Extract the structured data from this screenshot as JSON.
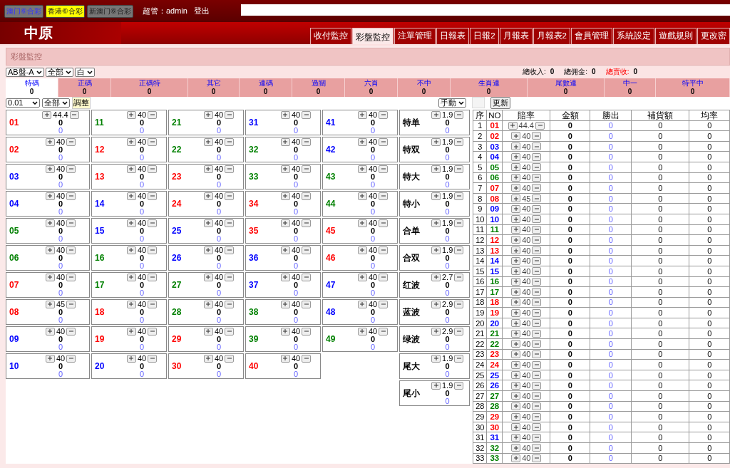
{
  "top_bar": {
    "sites": [
      {
        "label": "澳门⑥合彩",
        "selected": false,
        "kind": "link"
      },
      {
        "label": "香港⑥合彩",
        "selected": true,
        "kind": "plain"
      },
      {
        "label": "新澳门⑥合彩",
        "selected": false,
        "kind": "plain"
      }
    ],
    "user": "超管：admin",
    "logout": "登出"
  },
  "logo": "中原",
  "nav_tabs": [
    {
      "label": "收付監控",
      "selected": false
    },
    {
      "label": "彩盤監控",
      "selected": true
    },
    {
      "label": "注單管理",
      "selected": false
    },
    {
      "label": "日報表",
      "selected": false
    },
    {
      "label": "日報2",
      "selected": false
    },
    {
      "label": "月報表",
      "selected": false
    },
    {
      "label": "月報表2",
      "selected": false
    },
    {
      "label": "會員管理",
      "selected": false
    },
    {
      "label": "系統設定",
      "selected": false
    },
    {
      "label": "遊戲規則",
      "selected": false
    },
    {
      "label": "更改密",
      "selected": false
    }
  ],
  "panel_title": "彩盤監控",
  "filters": [
    "AB盤-A",
    "全部",
    "白"
  ],
  "totals": [
    {
      "label": "總收入:",
      "value": "0",
      "kind": "normal"
    },
    {
      "label": "總佣金:",
      "value": "0",
      "kind": "normal"
    },
    {
      "label": "總賣收:",
      "value": "0",
      "kind": "alert"
    }
  ],
  "categories": [
    {
      "label": "特碼",
      "value": "0",
      "selected": true
    },
    {
      "label": "正碼",
      "value": "0",
      "selected": false
    },
    {
      "label": "正碼特",
      "value": "0",
      "selected": false
    },
    {
      "label": "其它",
      "value": "0",
      "selected": false
    },
    {
      "label": "連碼",
      "value": "0",
      "selected": false
    },
    {
      "label": "過關",
      "value": "0",
      "selected": false
    },
    {
      "label": "六肖",
      "value": "0",
      "selected": false
    },
    {
      "label": "不中",
      "value": "0",
      "selected": false
    },
    {
      "label": "生肖連",
      "value": "0",
      "selected": false
    },
    {
      "label": "尾數連",
      "value": "0",
      "selected": false
    },
    {
      "label": "中一",
      "value": "0",
      "selected": false
    },
    {
      "label": "特平中",
      "value": "0",
      "selected": false
    }
  ],
  "step_select": "0.01",
  "scope_select": "全部",
  "adjust_button": "調整",
  "mode_select": "手動",
  "refresh_button": "更新",
  "balls": [
    {
      "no": "01",
      "color": "#ff0000",
      "odds": "44.4",
      "amount": "0",
      "win": "0"
    },
    {
      "no": "02",
      "color": "#ff0000",
      "odds": "40",
      "amount": "0",
      "win": "0"
    },
    {
      "no": "03",
      "color": "#0000ff",
      "odds": "40",
      "amount": "0",
      "win": "0"
    },
    {
      "no": "04",
      "color": "#0000ff",
      "odds": "40",
      "amount": "0",
      "win": "0"
    },
    {
      "no": "05",
      "color": "#008000",
      "odds": "40",
      "amount": "0",
      "win": "0"
    },
    {
      "no": "06",
      "color": "#008000",
      "odds": "40",
      "amount": "0",
      "win": "0"
    },
    {
      "no": "07",
      "color": "#ff0000",
      "odds": "40",
      "amount": "0",
      "win": "0"
    },
    {
      "no": "08",
      "color": "#ff0000",
      "odds": "45",
      "amount": "0",
      "win": "0"
    },
    {
      "no": "09",
      "color": "#0000ff",
      "odds": "40",
      "amount": "0",
      "win": "0"
    },
    {
      "no": "10",
      "color": "#0000ff",
      "odds": "40",
      "amount": "0",
      "win": "0"
    },
    {
      "no": "11",
      "color": "#008000",
      "odds": "40",
      "amount": "0",
      "win": "0"
    },
    {
      "no": "12",
      "color": "#ff0000",
      "odds": "40",
      "amount": "0",
      "win": "0"
    },
    {
      "no": "13",
      "color": "#ff0000",
      "odds": "40",
      "amount": "0",
      "win": "0"
    },
    {
      "no": "14",
      "color": "#0000ff",
      "odds": "40",
      "amount": "0",
      "win": "0"
    },
    {
      "no": "15",
      "color": "#0000ff",
      "odds": "40",
      "amount": "0",
      "win": "0"
    },
    {
      "no": "16",
      "color": "#008000",
      "odds": "40",
      "amount": "0",
      "win": "0"
    },
    {
      "no": "17",
      "color": "#008000",
      "odds": "40",
      "amount": "0",
      "win": "0"
    },
    {
      "no": "18",
      "color": "#ff0000",
      "odds": "40",
      "amount": "0",
      "win": "0"
    },
    {
      "no": "19",
      "color": "#ff0000",
      "odds": "40",
      "amount": "0",
      "win": "0"
    },
    {
      "no": "20",
      "color": "#0000ff",
      "odds": "40",
      "amount": "0",
      "win": "0"
    },
    {
      "no": "21",
      "color": "#008000",
      "odds": "40",
      "amount": "0",
      "win": "0"
    },
    {
      "no": "22",
      "color": "#008000",
      "odds": "40",
      "amount": "0",
      "win": "0"
    },
    {
      "no": "23",
      "color": "#ff0000",
      "odds": "40",
      "amount": "0",
      "win": "0"
    },
    {
      "no": "24",
      "color": "#ff0000",
      "odds": "40",
      "amount": "0",
      "win": "0"
    },
    {
      "no": "25",
      "color": "#0000ff",
      "odds": "40",
      "amount": "0",
      "win": "0"
    },
    {
      "no": "26",
      "color": "#0000ff",
      "odds": "40",
      "amount": "0",
      "win": "0"
    },
    {
      "no": "27",
      "color": "#008000",
      "odds": "40",
      "amount": "0",
      "win": "0"
    },
    {
      "no": "28",
      "color": "#008000",
      "odds": "40",
      "amount": "0",
      "win": "0"
    },
    {
      "no": "29",
      "color": "#ff0000",
      "odds": "40",
      "amount": "0",
      "win": "0"
    },
    {
      "no": "30",
      "color": "#ff0000",
      "odds": "40",
      "amount": "0",
      "win": "0"
    },
    {
      "no": "31",
      "color": "#0000ff",
      "odds": "40",
      "amount": "0",
      "win": "0"
    },
    {
      "no": "32",
      "color": "#008000",
      "odds": "40",
      "amount": "0",
      "win": "0"
    },
    {
      "no": "33",
      "color": "#008000",
      "odds": "40",
      "amount": "0",
      "win": "0"
    },
    {
      "no": "34",
      "color": "#ff0000",
      "odds": "40",
      "amount": "0",
      "win": "0"
    },
    {
      "no": "35",
      "color": "#ff0000",
      "odds": "40",
      "amount": "0",
      "win": "0"
    },
    {
      "no": "36",
      "color": "#0000ff",
      "odds": "40",
      "amount": "0",
      "win": "0"
    },
    {
      "no": "37",
      "color": "#0000ff",
      "odds": "40",
      "amount": "0",
      "win": "0"
    },
    {
      "no": "38",
      "color": "#008000",
      "odds": "40",
      "amount": "0",
      "win": "0"
    },
    {
      "no": "39",
      "color": "#008000",
      "odds": "40",
      "amount": "0",
      "win": "0"
    },
    {
      "no": "40",
      "color": "#ff0000",
      "odds": "40",
      "amount": "0",
      "win": "0"
    },
    {
      "no": "41",
      "color": "#0000ff",
      "odds": "40",
      "amount": "0",
      "win": "0"
    },
    {
      "no": "42",
      "color": "#0000ff",
      "odds": "40",
      "amount": "0",
      "win": "0"
    },
    {
      "no": "43",
      "color": "#008000",
      "odds": "40",
      "amount": "0",
      "win": "0"
    },
    {
      "no": "44",
      "color": "#008000",
      "odds": "40",
      "amount": "0",
      "win": "0"
    },
    {
      "no": "45",
      "color": "#ff0000",
      "odds": "40",
      "amount": "0",
      "win": "0"
    },
    {
      "no": "46",
      "color": "#ff0000",
      "odds": "40",
      "amount": "0",
      "win": "0"
    },
    {
      "no": "47",
      "color": "#0000ff",
      "odds": "40",
      "amount": "0",
      "win": "0"
    },
    {
      "no": "48",
      "color": "#0000ff",
      "odds": "40",
      "amount": "0",
      "win": "0"
    },
    {
      "no": "49",
      "color": "#008000",
      "odds": "40",
      "amount": "0",
      "win": "0"
    }
  ],
  "side_bets": [
    {
      "label": "特单",
      "odds": "1.9",
      "amount": "0",
      "win": "0"
    },
    {
      "label": "特双",
      "odds": "1.9",
      "amount": "0",
      "win": "0"
    },
    {
      "label": "特大",
      "odds": "1.9",
      "amount": "0",
      "win": "0"
    },
    {
      "label": "特小",
      "odds": "1.9",
      "amount": "0",
      "win": "0"
    },
    {
      "label": "合单",
      "odds": "1.9",
      "amount": "0",
      "win": "0"
    },
    {
      "label": "合双",
      "odds": "1.9",
      "amount": "0",
      "win": "0"
    },
    {
      "label": "红波",
      "odds": "2.7",
      "amount": "0",
      "win": "0"
    },
    {
      "label": "蓝波",
      "odds": "2.9",
      "amount": "0",
      "win": "0"
    },
    {
      "label": "绿波",
      "odds": "2.9",
      "amount": "0",
      "win": "0"
    },
    {
      "label": "尾大",
      "odds": "1.9",
      "amount": "0",
      "win": "0"
    },
    {
      "label": "尾小",
      "odds": "1.9",
      "amount": "0",
      "win": "0"
    }
  ],
  "table": {
    "columns": [
      "序",
      "NO",
      "賠率",
      "金額",
      "勝出",
      "補貨額",
      "均率"
    ],
    "rows": [
      {
        "seq": "1",
        "no": "01",
        "color": "#ff0000",
        "odds": "44.4",
        "amount": "0",
        "win": "0",
        "cover": "0",
        "avg": "0"
      },
      {
        "seq": "2",
        "no": "02",
        "color": "#ff0000",
        "odds": "40",
        "amount": "0",
        "win": "0",
        "cover": "0",
        "avg": "0"
      },
      {
        "seq": "3",
        "no": "03",
        "color": "#0000ff",
        "odds": "40",
        "amount": "0",
        "win": "0",
        "cover": "0",
        "avg": "0"
      },
      {
        "seq": "4",
        "no": "04",
        "color": "#0000ff",
        "odds": "40",
        "amount": "0",
        "win": "0",
        "cover": "0",
        "avg": "0"
      },
      {
        "seq": "5",
        "no": "05",
        "color": "#008000",
        "odds": "40",
        "amount": "0",
        "win": "0",
        "cover": "0",
        "avg": "0"
      },
      {
        "seq": "6",
        "no": "06",
        "color": "#008000",
        "odds": "40",
        "amount": "0",
        "win": "0",
        "cover": "0",
        "avg": "0"
      },
      {
        "seq": "7",
        "no": "07",
        "color": "#ff0000",
        "odds": "40",
        "amount": "0",
        "win": "0",
        "cover": "0",
        "avg": "0"
      },
      {
        "seq": "8",
        "no": "08",
        "color": "#ff0000",
        "odds": "45",
        "amount": "0",
        "win": "0",
        "cover": "0",
        "avg": "0"
      },
      {
        "seq": "9",
        "no": "09",
        "color": "#0000ff",
        "odds": "40",
        "amount": "0",
        "win": "0",
        "cover": "0",
        "avg": "0"
      },
      {
        "seq": "10",
        "no": "10",
        "color": "#0000ff",
        "odds": "40",
        "amount": "0",
        "win": "0",
        "cover": "0",
        "avg": "0"
      },
      {
        "seq": "11",
        "no": "11",
        "color": "#008000",
        "odds": "40",
        "amount": "0",
        "win": "0",
        "cover": "0",
        "avg": "0"
      },
      {
        "seq": "12",
        "no": "12",
        "color": "#ff0000",
        "odds": "40",
        "amount": "0",
        "win": "0",
        "cover": "0",
        "avg": "0"
      },
      {
        "seq": "13",
        "no": "13",
        "color": "#ff0000",
        "odds": "40",
        "amount": "0",
        "win": "0",
        "cover": "0",
        "avg": "0"
      },
      {
        "seq": "14",
        "no": "14",
        "color": "#0000ff",
        "odds": "40",
        "amount": "0",
        "win": "0",
        "cover": "0",
        "avg": "0"
      },
      {
        "seq": "15",
        "no": "15",
        "color": "#0000ff",
        "odds": "40",
        "amount": "0",
        "win": "0",
        "cover": "0",
        "avg": "0"
      },
      {
        "seq": "16",
        "no": "16",
        "color": "#008000",
        "odds": "40",
        "amount": "0",
        "win": "0",
        "cover": "0",
        "avg": "0"
      },
      {
        "seq": "17",
        "no": "17",
        "color": "#008000",
        "odds": "40",
        "amount": "0",
        "win": "0",
        "cover": "0",
        "avg": "0"
      },
      {
        "seq": "18",
        "no": "18",
        "color": "#ff0000",
        "odds": "40",
        "amount": "0",
        "win": "0",
        "cover": "0",
        "avg": "0"
      },
      {
        "seq": "19",
        "no": "19",
        "color": "#ff0000",
        "odds": "40",
        "amount": "0",
        "win": "0",
        "cover": "0",
        "avg": "0"
      },
      {
        "seq": "20",
        "no": "20",
        "color": "#0000ff",
        "odds": "40",
        "amount": "0",
        "win": "0",
        "cover": "0",
        "avg": "0"
      },
      {
        "seq": "21",
        "no": "21",
        "color": "#008000",
        "odds": "40",
        "amount": "0",
        "win": "0",
        "cover": "0",
        "avg": "0"
      },
      {
        "seq": "22",
        "no": "22",
        "color": "#008000",
        "odds": "40",
        "amount": "0",
        "win": "0",
        "cover": "0",
        "avg": "0"
      },
      {
        "seq": "23",
        "no": "23",
        "color": "#ff0000",
        "odds": "40",
        "amount": "0",
        "win": "0",
        "cover": "0",
        "avg": "0"
      },
      {
        "seq": "24",
        "no": "24",
        "color": "#ff0000",
        "odds": "40",
        "amount": "0",
        "win": "0",
        "cover": "0",
        "avg": "0"
      },
      {
        "seq": "25",
        "no": "25",
        "color": "#0000ff",
        "odds": "40",
        "amount": "0",
        "win": "0",
        "cover": "0",
        "avg": "0"
      },
      {
        "seq": "26",
        "no": "26",
        "color": "#0000ff",
        "odds": "40",
        "amount": "0",
        "win": "0",
        "cover": "0",
        "avg": "0"
      },
      {
        "seq": "27",
        "no": "27",
        "color": "#008000",
        "odds": "40",
        "amount": "0",
        "win": "0",
        "cover": "0",
        "avg": "0"
      },
      {
        "seq": "28",
        "no": "28",
        "color": "#008000",
        "odds": "40",
        "amount": "0",
        "win": "0",
        "cover": "0",
        "avg": "0"
      },
      {
        "seq": "29",
        "no": "29",
        "color": "#ff0000",
        "odds": "40",
        "amount": "0",
        "win": "0",
        "cover": "0",
        "avg": "0"
      },
      {
        "seq": "30",
        "no": "30",
        "color": "#ff0000",
        "odds": "40",
        "amount": "0",
        "win": "0",
        "cover": "0",
        "avg": "0"
      },
      {
        "seq": "31",
        "no": "31",
        "color": "#0000ff",
        "odds": "40",
        "amount": "0",
        "win": "0",
        "cover": "0",
        "avg": "0"
      },
      {
        "seq": "32",
        "no": "32",
        "color": "#008000",
        "odds": "40",
        "amount": "0",
        "win": "0",
        "cover": "0",
        "avg": "0"
      },
      {
        "seq": "33",
        "no": "33",
        "color": "#008000",
        "odds": "40",
        "amount": "0",
        "win": "0",
        "cover": "0",
        "avg": "0"
      }
    ]
  }
}
